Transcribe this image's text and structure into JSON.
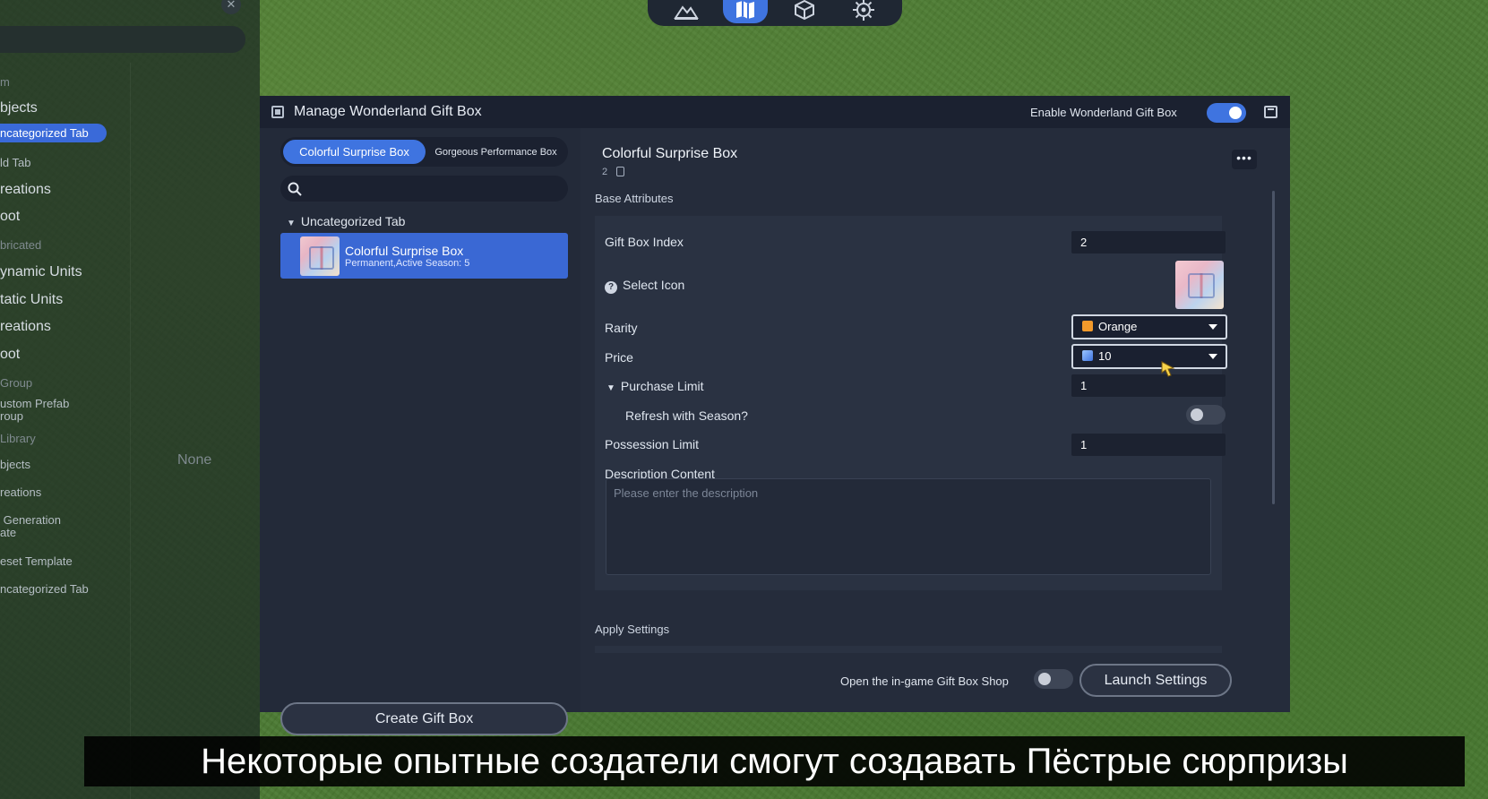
{
  "background_panel": {
    "items": [
      "m",
      "bjects",
      "ncategorized Tab",
      "ld Tab",
      "reations",
      "oot",
      "bricated",
      "ynamic Units",
      "tatic Units",
      "reations",
      "oot",
      "Group",
      "ustom Prefab\nroup",
      "Library",
      "bjects",
      "reations",
      " Generation\nate",
      "eset Template",
      "ncategorized Tab"
    ],
    "none_label": "None"
  },
  "toolbar": {
    "buttons": [
      "terrain-icon",
      "map-icon",
      "cube-icon",
      "gear-icon"
    ],
    "active_index": 1
  },
  "dialog": {
    "title": "Manage Wonderland Gift Box",
    "enable_label": "Enable Wonderland Gift Box",
    "enable_on": true,
    "tabs": [
      "Colorful Surprise Box",
      "Gorgeous Performance Box"
    ],
    "active_tab": 0,
    "search_placeholder": "",
    "tree_group": "Uncategorized Tab",
    "gift_items": [
      {
        "name": "Colorful Surprise Box",
        "subtitle": "Permanent,Active Season: 5"
      }
    ],
    "create_button": "Create Gift Box",
    "detail": {
      "title": "Colorful Surprise Box",
      "id": "2",
      "more_label": "•••",
      "base_attributes_label": "Base Attributes",
      "gift_box_index_label": "Gift Box Index",
      "gift_box_index_value": "2",
      "select_icon_label": "Select Icon",
      "rarity_label": "Rarity",
      "rarity_value": "Orange",
      "rarity_color": "#f39a2b",
      "price_label": "Price",
      "price_value": "10",
      "purchase_limit_label": "Purchase Limit",
      "purchase_limit_value": "1",
      "refresh_label": "Refresh with Season?",
      "refresh_on": false,
      "possession_limit_label": "Possession Limit",
      "possession_limit_value": "1",
      "description_label": "Description Content",
      "description_placeholder": "Please enter the description",
      "apply_settings_label": "Apply Settings"
    },
    "open_shop_label": "Open the in-game Gift Box Shop",
    "open_shop_on": false,
    "launch_button": "Launch Settings"
  },
  "subtitle": "Некоторые опытные создатели смогут создавать Пёстрые сюрпризы",
  "colors": {
    "accent": "#3f74e0",
    "dialog_bg": "#232a39",
    "header_bg": "#1b2130"
  }
}
